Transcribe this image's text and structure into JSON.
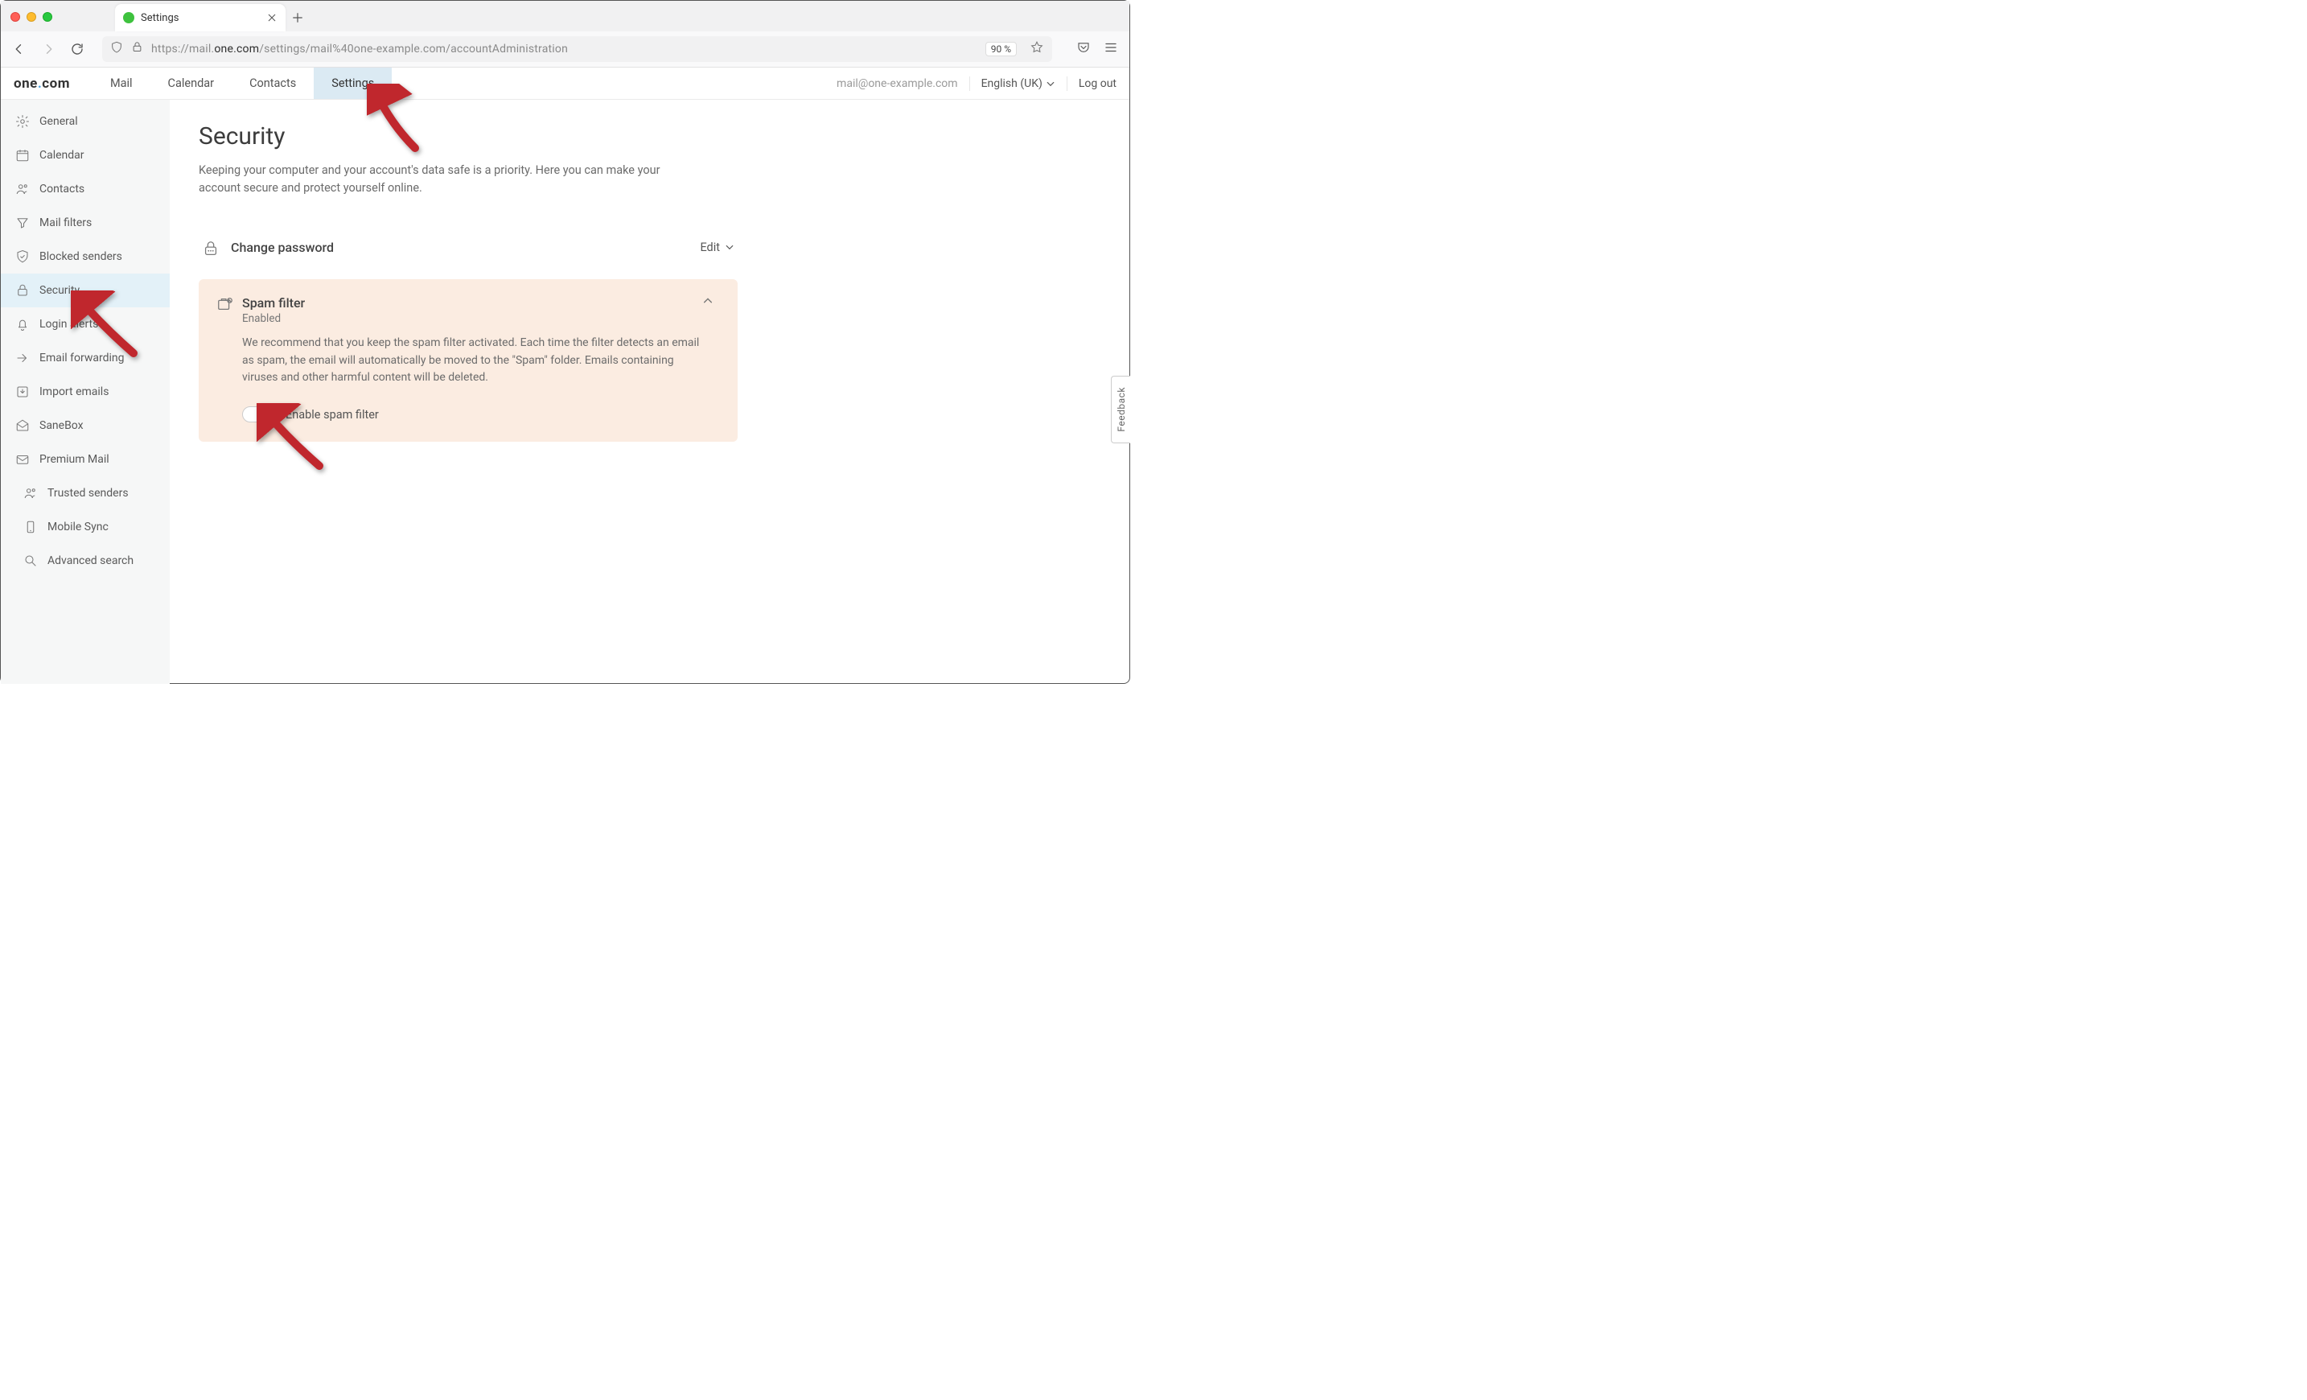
{
  "browser": {
    "tab_title": "Settings",
    "url_prefix": "https://mail.",
    "url_bold": "one.com",
    "url_suffix": "/settings/mail%40one-example.com/accountAdministration",
    "zoom": "90 %"
  },
  "header": {
    "logo_one": "one",
    "logo_dot": ".",
    "logo_com": "com",
    "nav": [
      "Mail",
      "Calendar",
      "Contacts",
      "Settings"
    ],
    "active_nav_index": 3,
    "email": "mail@one-example.com",
    "language": "English (UK)",
    "logout": "Log out"
  },
  "sidebar": {
    "items": [
      {
        "label": "General",
        "icon": "gear"
      },
      {
        "label": "Calendar",
        "icon": "calendar"
      },
      {
        "label": "Contacts",
        "icon": "contacts"
      },
      {
        "label": "Mail filters",
        "icon": "filter"
      },
      {
        "label": "Blocked senders",
        "icon": "shield"
      },
      {
        "label": "Security",
        "icon": "lock",
        "active": true
      },
      {
        "label": "Login alerts",
        "icon": "bell"
      },
      {
        "label": "Email forwarding",
        "icon": "forward"
      },
      {
        "label": "Import emails",
        "icon": "import"
      },
      {
        "label": "SaneBox",
        "icon": "mailopen"
      },
      {
        "label": "Premium Mail",
        "icon": "premium"
      },
      {
        "label": "Trusted senders",
        "icon": "contacts",
        "sub": true
      },
      {
        "label": "Mobile Sync",
        "icon": "phone",
        "sub": true
      },
      {
        "label": "Advanced search",
        "icon": "search",
        "sub": true
      }
    ]
  },
  "page": {
    "title": "Security",
    "description": "Keeping your computer and your account's data safe is a priority. Here you can make your account secure and protect yourself online.",
    "change_password": {
      "label": "Change password",
      "edit": "Edit"
    },
    "spam": {
      "title": "Spam filter",
      "status": "Enabled",
      "desc": "We recommend that you keep the spam filter activated. Each time the filter detects an email as spam, the email will automatically be moved to the \"Spam\" folder. Emails containing viruses and other harmful content will be deleted.",
      "toggle_label": "Enable spam filter",
      "toggle_on": true
    }
  },
  "feedback": "Feedback"
}
